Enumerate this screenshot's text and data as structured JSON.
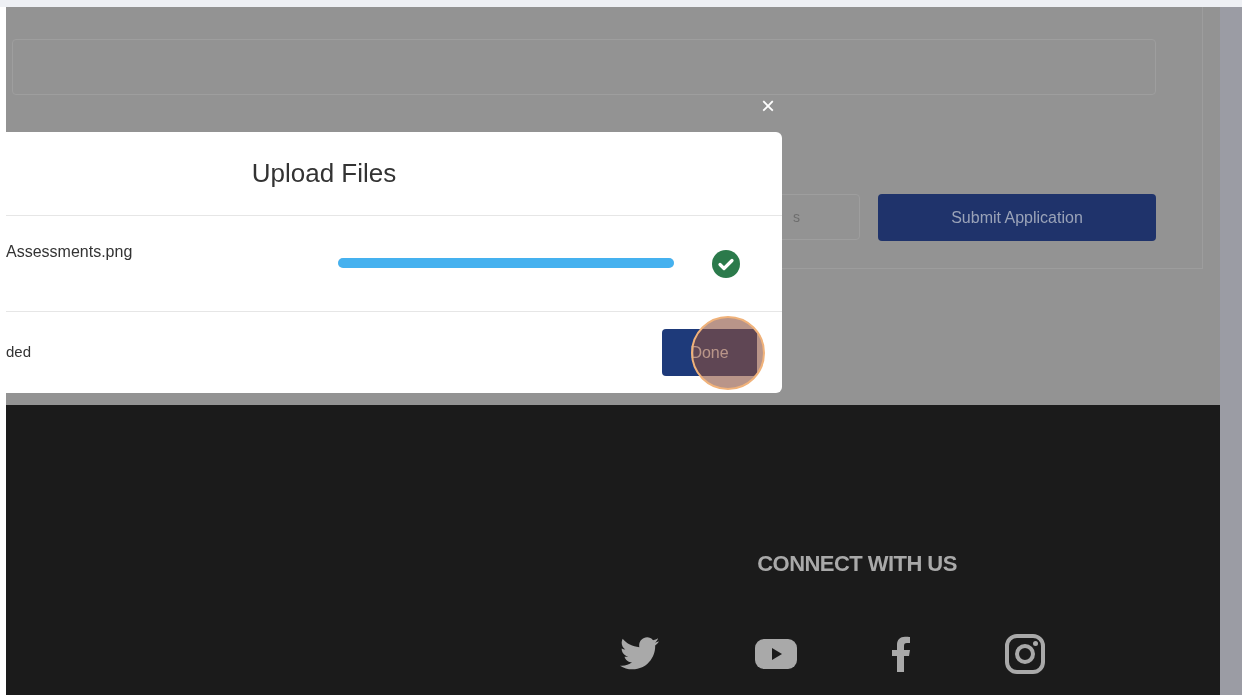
{
  "application_form": {
    "secondary_button": "s",
    "submit_button": "Submit Application"
  },
  "dialog": {
    "close": "×",
    "title": "Upload Files",
    "files": [
      {
        "name": "Assessments.png",
        "level": 1,
        "done": true
      }
    ],
    "status": "ded",
    "done_button": "Done"
  },
  "footer": {
    "heading": "CONNECT WITH US",
    "social": [
      {
        "kind": "twitter"
      },
      {
        "kind": "youtube"
      },
      {
        "kind": "facebook"
      },
      {
        "kind": "instagram"
      }
    ]
  }
}
